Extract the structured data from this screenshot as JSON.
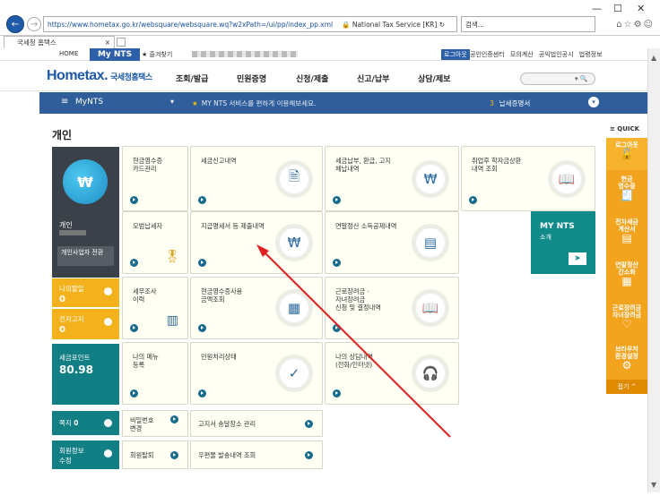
{
  "browser": {
    "url": "https://www.hometax.go.kr/websquare/websquare.wq?w2xPath=/ui/pp/index_pp.xml",
    "site_cert": "National Tax Service [KR]",
    "search_placeholder": "검색...",
    "tab_title": "국세청 홈택스",
    "controls": [
      "—",
      "☐",
      "✕"
    ]
  },
  "util_bar": {
    "home": "HOME",
    "mynts": "My NTS",
    "favorites": "★ 즐겨찾기",
    "login": "로그아웃",
    "links": [
      "공인인증센터",
      "모의계산",
      "공익법인공시",
      "법령정보"
    ]
  },
  "gnb": {
    "logo": "Hometax.",
    "logo_sub": "국세청홈택스",
    "menus": [
      "조회/발급",
      "민원증명",
      "신청/제출",
      "신고/납부",
      "상담/제보"
    ]
  },
  "mynts_bar": {
    "title": "MyNTS",
    "notice": "MY NTS 서비스를 편하게 이용해보세요.",
    "right_num": "3",
    "right_label": "납세증명서"
  },
  "content": {
    "title": "개인",
    "profile": {
      "name": "개인",
      "business_label": "개인사업자 전환"
    },
    "side_tiles": [
      {
        "label": "나의할일",
        "count": "0"
      },
      {
        "label": "전자고지",
        "count": "0"
      },
      {
        "label": "세금포인트",
        "count": "80.98"
      },
      {
        "label": "쪽지",
        "count": "0"
      },
      {
        "label": "회원정보 수정",
        "count": ""
      }
    ],
    "cards": [
      {
        "label": "현금영수증\n카드관리",
        "icon": "card-icon"
      },
      {
        "label": "세금신고내역",
        "icon": "tax-doc-icon"
      },
      {
        "label": "세금납부, 환급, 고지\n체납내역",
        "icon": "won-coin-icon"
      },
      {
        "label": "취업후 학자금상환\n내역 조회",
        "icon": "book-icon"
      },
      {
        "label": "모범납세자",
        "icon": "medal-icon"
      },
      {
        "label": "지급명세서 등 제출내역",
        "icon": "won-doc-icon"
      },
      {
        "label": "연말정산 소득공제내역",
        "icon": "ledger-icon"
      },
      {
        "label": "세무조사\n이력",
        "icon": "binder-icon"
      },
      {
        "label": "현금영수증사용\n금액조회",
        "icon": "receipt-icon"
      },
      {
        "label": "근로장려금 ·\n자녀장려금\n신청 및 결정내역",
        "icon": "book-open-icon"
      },
      {
        "label": "나의 메뉴\n등록",
        "icon": ""
      },
      {
        "label": "민원처리상태",
        "icon": "check-icon"
      },
      {
        "label": "나의 상담내역\n(전화/인터넷)",
        "icon": "headset-icon"
      }
    ],
    "wide_cards": [
      {
        "label": "비밀번호\n변경"
      },
      {
        "label": "고지서 송달장소 관리"
      },
      {
        "label": "회원탈퇴"
      },
      {
        "label": "우편물 발송내역 조회"
      }
    ],
    "mynts_tile": {
      "title": "MY NTS",
      "sub": "소개"
    }
  },
  "quick": {
    "title": "≡ QUICK",
    "items": [
      "로그아웃",
      "현금\n영수증",
      "전자세금\n계산서",
      "연말정산\n간소화",
      "근로장려금\n자녀장려금",
      "브라우저\n환경설정"
    ],
    "close": "접기 ^"
  }
}
